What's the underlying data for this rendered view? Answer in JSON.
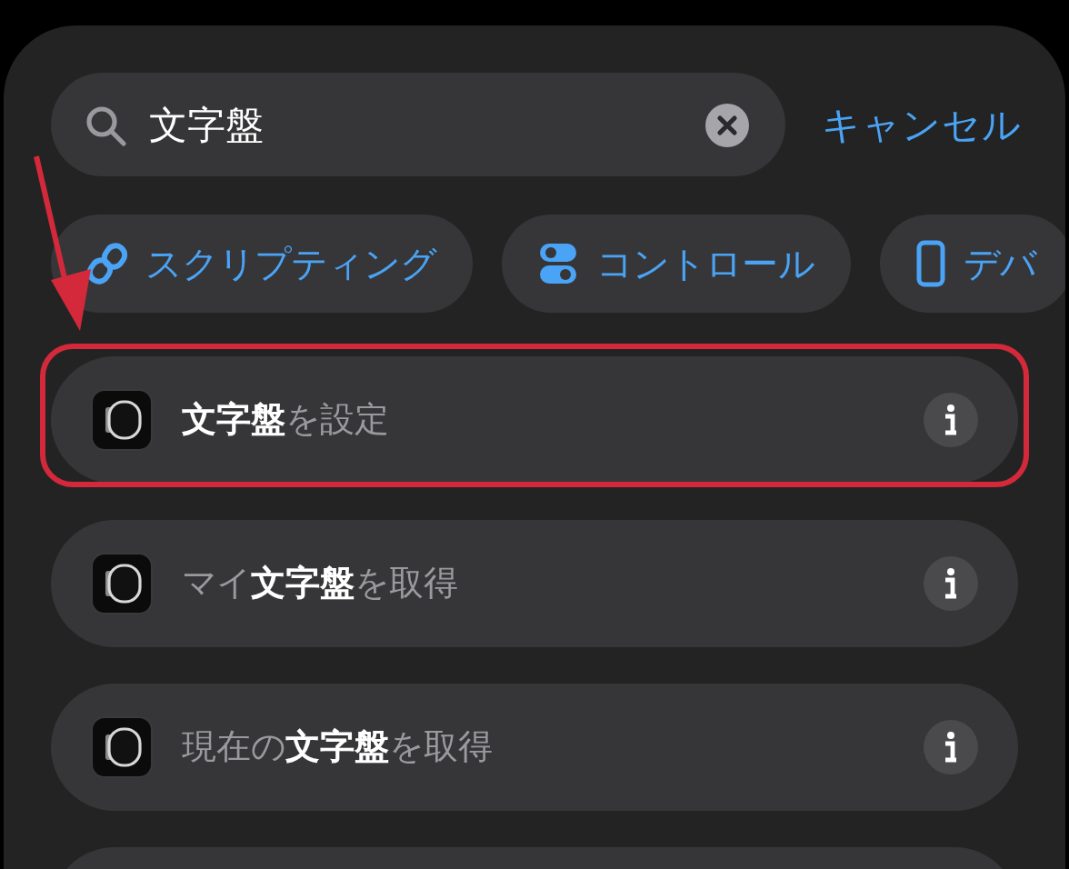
{
  "search": {
    "value": "文字盤"
  },
  "cancel": "キャンセル",
  "categories": [
    {
      "label": "スクリプティング",
      "kind": "link"
    },
    {
      "label": "コントロール",
      "kind": "toggle"
    },
    {
      "label": "デバ",
      "kind": "phone"
    }
  ],
  "actions": [
    {
      "title": "**文字盤**を設定",
      "highlighted": true
    },
    {
      "title": "マイ**文字盤**を取得",
      "highlighted": false
    },
    {
      "title": "現在の**文字盤**を取得",
      "highlighted": false
    }
  ]
}
